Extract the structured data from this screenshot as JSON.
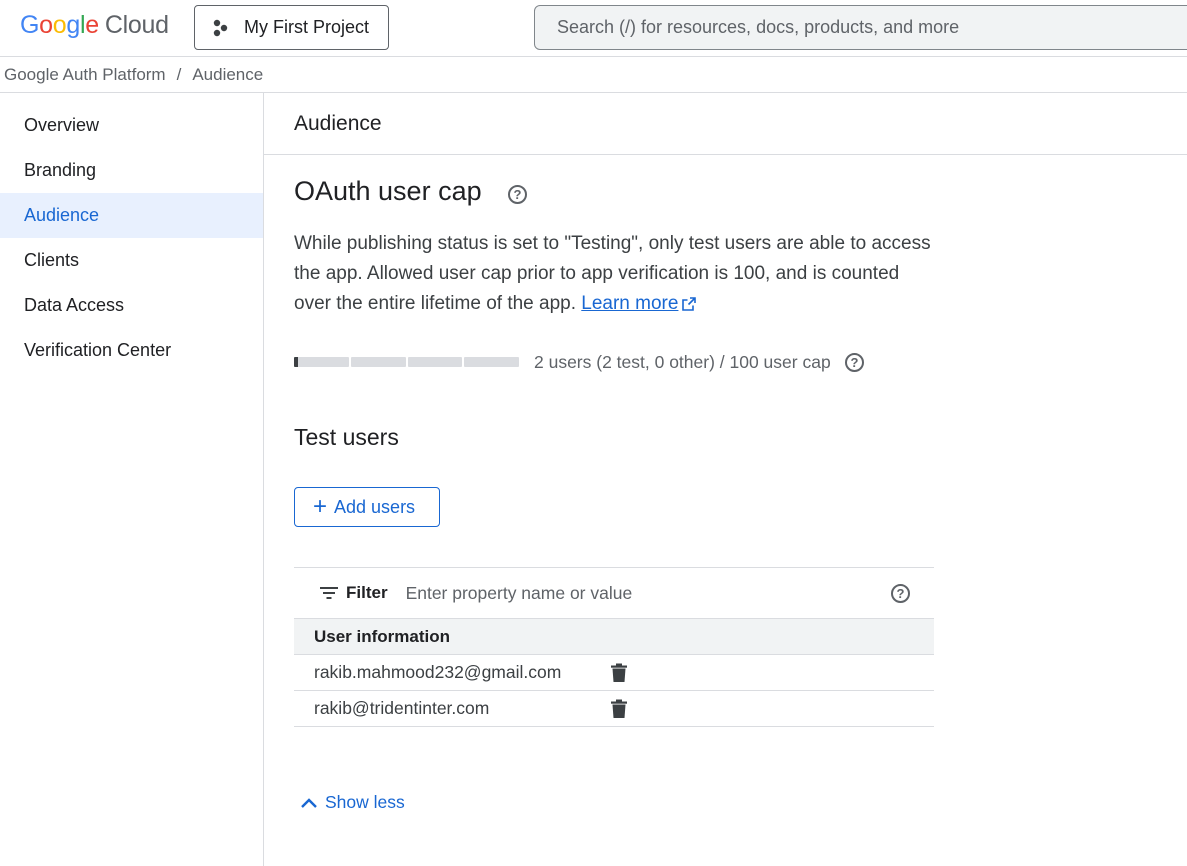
{
  "header": {
    "logo_text": "Google",
    "logo_product": "Cloud",
    "project_label": "My First Project",
    "search_placeholder": "Search (/) for resources, docs, products, and more"
  },
  "breadcrumb": [
    "Google Auth Platform",
    "/",
    "Audience"
  ],
  "sidebar": {
    "items": [
      {
        "label": "Overview",
        "active": false
      },
      {
        "label": "Branding",
        "active": false
      },
      {
        "label": "Audience",
        "active": true
      },
      {
        "label": "Clients",
        "active": false
      },
      {
        "label": "Data Access",
        "active": false
      },
      {
        "label": "Verification Center",
        "active": false
      }
    ]
  },
  "page": {
    "title": "Audience"
  },
  "user_cap": {
    "heading": "OAuth user cap",
    "description": "While publishing status is set to \"Testing\", only test users are able to access the app. Allowed user cap prior to app verification is 100, and is counted over the entire lifetime of the app.",
    "learn_more": "Learn more",
    "usage_text": "2 users (2 test, 0 other) / 100 user cap",
    "used": 2,
    "cap": 100
  },
  "test_users": {
    "heading": "Test users",
    "add_button": "Add users",
    "filter_label": "Filter",
    "filter_placeholder": "Enter property name or value",
    "column_header": "User information",
    "rows": [
      "rakib.mahmood232@gmail.com",
      "rakib@tridentinter.com"
    ],
    "show_less": "Show less"
  },
  "colors": {
    "accent": "#1967d2",
    "active_bg": "#e8f0fe",
    "border": "#dadce0"
  }
}
